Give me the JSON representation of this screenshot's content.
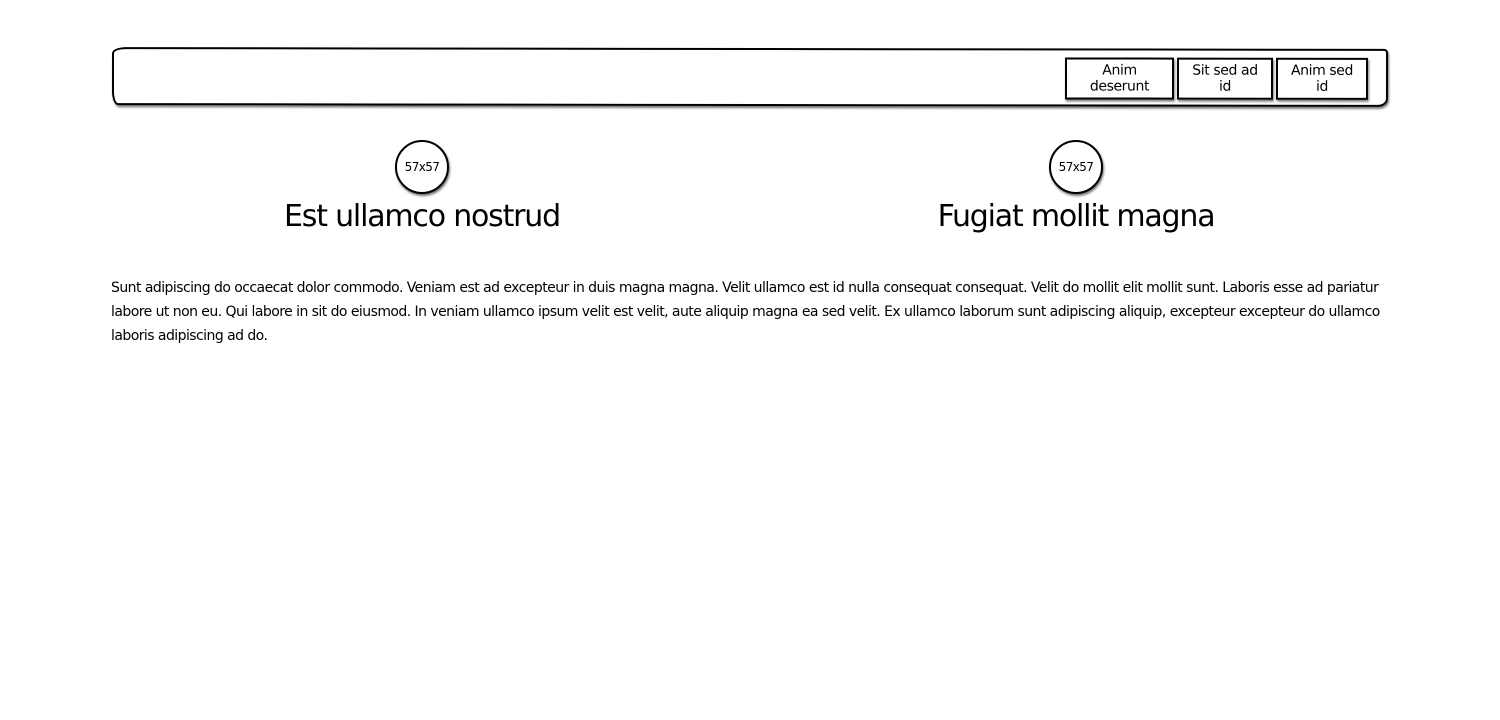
{
  "navbar": {
    "buttons": [
      {
        "label": "Anim deserunt"
      },
      {
        "label": "Sit sed ad id"
      },
      {
        "label": "Anim sed id"
      }
    ]
  },
  "features": [
    {
      "image_label": "57x57",
      "title": "Est ullamco nostrud"
    },
    {
      "image_label": "57x57",
      "title": "Fugiat mollit magna"
    }
  ],
  "body": {
    "paragraph": "Sunt adipiscing do occaecat dolor commodo. Veniam est ad excepteur in duis magna magna. Velit ullamco est id nulla consequat consequat. Velit do mollit elit mollit sunt. Laboris esse ad pariatur labore ut non eu. Qui labore in sit do eiusmod. In veniam ullamco ipsum velit est velit, aute aliquip magna ea sed velit. Ex ullamco laborum sunt adipiscing aliquip, excepteur excepteur do ullamco laboris adipiscing ad do."
  }
}
